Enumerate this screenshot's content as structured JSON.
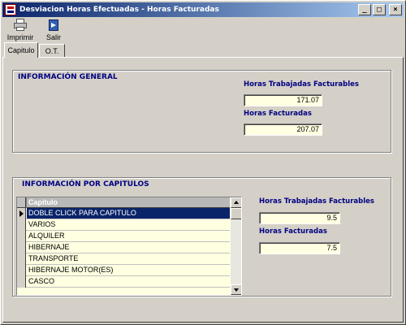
{
  "window": {
    "title": "Desviacion Horas Efectuadas - Horas Facturadas",
    "controls": {
      "minimize": "_",
      "maximize": "□",
      "close": "×"
    }
  },
  "toolbar": {
    "print_label": "Imprimir",
    "exit_label": "Salir",
    "print_icon": "printer-icon",
    "exit_icon": "exit-door-icon"
  },
  "tabs": [
    {
      "label": "Capitulo",
      "active": true
    },
    {
      "label": "O.T.",
      "active": false
    }
  ],
  "general": {
    "title": "INFORMACIÓN GENERAL",
    "billable_hours_label": "Horas Trabajadas Facturables",
    "billable_hours_value": "171.07",
    "billed_hours_label": "Horas Facturadas",
    "billed_hours_value": "207.07"
  },
  "chapters": {
    "title": "INFORMACIÓN POR CAPITULOS",
    "column_header": "Capitulo",
    "rows": [
      "DOBLE CLICK PARA CAPITULO",
      "VARIOS",
      "ALQUILER",
      "HIBERNAJE",
      "TRANSPORTE",
      "HIBERNAJE MOTOR(ES)",
      "CASCO"
    ],
    "selected_index": 0,
    "billable_hours_label": "Horas Trabajadas Facturables",
    "billable_hours_value": "9.5",
    "billed_hours_label": "Horas Facturadas",
    "billed_hours_value": "7.5"
  },
  "colors": {
    "title_bar_start": "#0a246a",
    "title_bar_end": "#a6caf0",
    "label_blue": "#000080",
    "field_background": "#ffffe1",
    "selection": "#0a246a"
  }
}
